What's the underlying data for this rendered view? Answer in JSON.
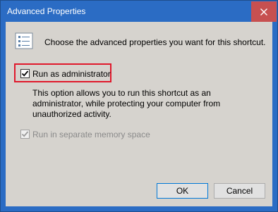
{
  "window": {
    "title": "Advanced Properties"
  },
  "intro": {
    "text": "Choose the advanced properties you want for this shortcut."
  },
  "options": {
    "run_as_admin": {
      "label": "Run as administrator",
      "checked": true
    },
    "description": "This option allows you to run this shortcut as an administrator, while protecting your computer from unauthorized activity.",
    "separate_memory": {
      "label": "Run in separate memory space",
      "checked": true,
      "disabled": true
    }
  },
  "buttons": {
    "ok": "OK",
    "cancel": "Cancel"
  },
  "icons": {
    "close": "close-icon",
    "properties": "properties-list-icon",
    "check": "checkmark-icon"
  },
  "colors": {
    "titlebar": "#2b6cc4",
    "close": "#c75050",
    "highlight": "#e0182b",
    "dialog": "#d6d3ce"
  }
}
